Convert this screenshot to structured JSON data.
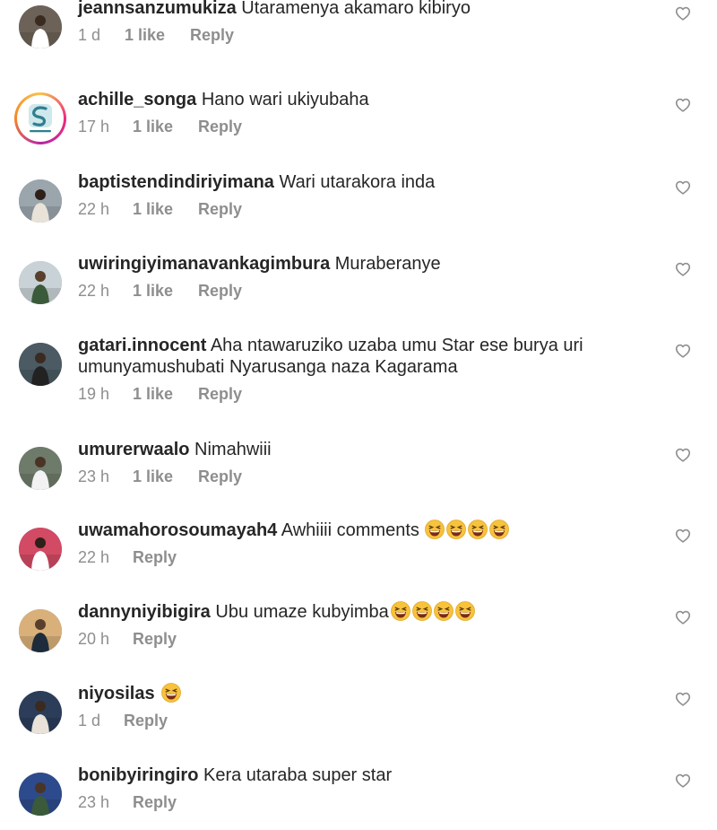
{
  "comments": [
    {
      "username": "jeannsanzumukiza",
      "text": "Utaramenya akamaro kibiryo",
      "time": "1 d",
      "likes": "1 like",
      "reply": "Reply",
      "emoji_count": 0,
      "avatar": "photo"
    },
    {
      "username": "achille_songa",
      "text": "Hano wari ukiyubaha",
      "time": "17 h",
      "likes": "1 like",
      "reply": "Reply",
      "emoji_count": 0,
      "avatar": "logo"
    },
    {
      "username": "baptistendindiriyimana",
      "text": "Wari utarakora inda",
      "time": "22 h",
      "likes": "1 like",
      "reply": "Reply",
      "emoji_count": 0,
      "avatar": "photo"
    },
    {
      "username": "uwiringiyimanavankagimbura",
      "text": "Muraberanye",
      "time": "22 h",
      "likes": "1 like",
      "reply": "Reply",
      "emoji_count": 0,
      "avatar": "photo"
    },
    {
      "username": "gatari.innocent",
      "text": "Aha ntawaruziko uzaba umu Star ese burya uri umunyamushubati Nyarusanga naza Kagarama",
      "time": "19 h",
      "likes": "1 like",
      "reply": "Reply",
      "emoji_count": 0,
      "avatar": "photo"
    },
    {
      "username": "umurerwaalo",
      "text": "Nimahwiii",
      "time": "23 h",
      "likes": "1 like",
      "reply": "Reply",
      "emoji_count": 0,
      "avatar": "photo"
    },
    {
      "username": "uwamahorosoumayah4",
      "text": "Awhiiii comments",
      "time": "22 h",
      "likes": "",
      "reply": "Reply",
      "emoji_count": 4,
      "avatar": "photo"
    },
    {
      "username": "dannyniyibigira",
      "text": "Ubu umaze kubyimba",
      "time": "20 h",
      "likes": "",
      "reply": "Reply",
      "emoji_count": 4,
      "avatar": "photo"
    },
    {
      "username": "niyosilas",
      "text": "",
      "time": "1 d",
      "likes": "",
      "reply": "Reply",
      "emoji_count": 1,
      "avatar": "photo"
    },
    {
      "username": "bonibyiringiro",
      "text": "Kera utaraba super star",
      "time": "23 h",
      "likes": "",
      "reply": "Reply",
      "emoji_count": 0,
      "avatar": "photo"
    }
  ],
  "icons": {
    "like": "heart-outline-icon",
    "emoji": "grinning-squinting-face-emoji"
  },
  "colors": {
    "text": "#262626",
    "meta": "#8e8e8e",
    "heart": "#8e8e8e"
  }
}
